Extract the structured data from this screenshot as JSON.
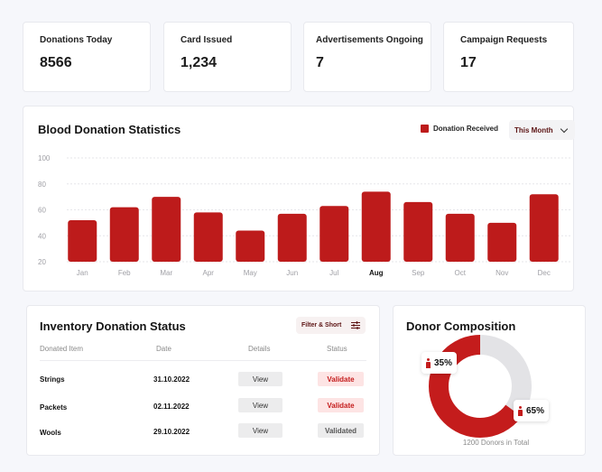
{
  "stats": [
    {
      "label": "Donations Today",
      "value": "8566"
    },
    {
      "label": "Card Issued",
      "value": "1,234"
    },
    {
      "label": "Advertisements Ongoing",
      "value": "7"
    },
    {
      "label": "Campaign Requests",
      "value": "17"
    }
  ],
  "statistics": {
    "title": "Blood Donation Statistics",
    "legend_label": "Donation Received",
    "period_select": "This Month"
  },
  "chart_data": {
    "type": "bar",
    "title": "Blood Donation Statistics",
    "categories": [
      "Jan",
      "Feb",
      "Mar",
      "Apr",
      "May",
      "Jun",
      "Jul",
      "Aug",
      "Sep",
      "Oct",
      "Nov",
      "Dec"
    ],
    "series": [
      {
        "name": "Donation Received",
        "values": [
          52,
          62,
          70,
          58,
          44,
          57,
          63,
          74,
          66,
          57,
          50,
          72
        ]
      }
    ],
    "yticks": [
      20,
      40,
      60,
      80,
      100
    ],
    "ylim": [
      20,
      100
    ],
    "highlighted_category": "Aug",
    "grid": true,
    "legend_position": "top-right",
    "color": "#bd1b1b"
  },
  "inventory": {
    "title": "Inventory Donation Status",
    "filter_label": "Filter & Short",
    "columns": [
      "Donated Item",
      "Date",
      "Details",
      "Status"
    ],
    "rows": [
      {
        "item": "Strings",
        "date": "31.10.2022",
        "details": "View",
        "status": "Validate"
      },
      {
        "item": "Packets",
        "date": "02.11.2022",
        "details": "View",
        "status": "Validate"
      },
      {
        "item": "Wools",
        "date": "29.10.2022",
        "details": "View",
        "status": "Validated"
      }
    ]
  },
  "donor": {
    "title": "Donor Composition",
    "segments": [
      {
        "label": "35%",
        "value": 35,
        "color": "#e3e3e6"
      },
      {
        "label": "65%",
        "value": 65,
        "color": "#c41c1c"
      }
    ],
    "total_text": "1200 Donors in Total"
  }
}
